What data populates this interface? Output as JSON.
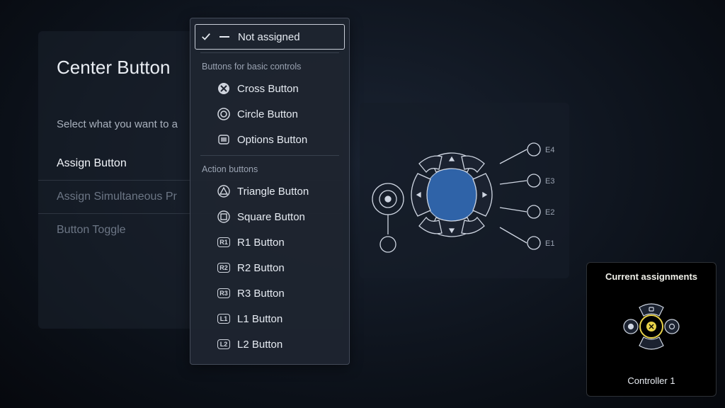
{
  "page": {
    "title": "Center Button",
    "prompt": "Select what you want to a"
  },
  "sidebar": {
    "items": [
      {
        "label": "Assign Button",
        "active": true
      },
      {
        "label": "Assign Simultaneous Pr",
        "active": false
      },
      {
        "label": "Button Toggle",
        "active": false
      }
    ]
  },
  "dropdown": {
    "selected": "Not assigned",
    "sections": [
      {
        "label": "Buttons for basic controls",
        "items": [
          {
            "icon": "cross",
            "label": "Cross Button"
          },
          {
            "icon": "circle",
            "label": "Circle Button"
          },
          {
            "icon": "options",
            "label": "Options Button"
          }
        ]
      },
      {
        "label": "Action buttons",
        "items": [
          {
            "icon": "triangle",
            "label": "Triangle Button"
          },
          {
            "icon": "square",
            "label": "Square Button"
          },
          {
            "icon": "pill",
            "pill": "R1",
            "label": "R1 Button"
          },
          {
            "icon": "pill",
            "pill": "R2",
            "label": "R2 Button"
          },
          {
            "icon": "pill",
            "pill": "R3",
            "label": "R3 Button"
          },
          {
            "icon": "pill",
            "pill": "L1",
            "label": "L1 Button"
          },
          {
            "icon": "pill",
            "pill": "L2",
            "label": "L2 Button"
          }
        ]
      }
    ]
  },
  "diagram": {
    "expansion_labels": [
      "E4",
      "E3",
      "E2",
      "E1"
    ]
  },
  "assignments": {
    "title": "Current assignments",
    "controller": "Controller 1"
  }
}
